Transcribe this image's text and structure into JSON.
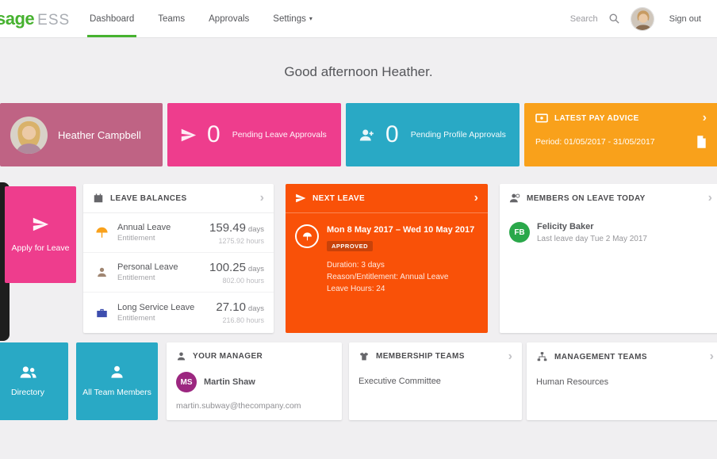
{
  "colors": {
    "sage_green": "#46b22f",
    "pink": "#ee3d8d",
    "mauve": "#bf6384",
    "cyan": "#29a9c5",
    "amber": "#f9a11b",
    "orange": "#f95108",
    "fb_green": "#2aa84a",
    "ms_purple": "#9c2780"
  },
  "icons": {
    "chevron_right": "›",
    "caret_down": "▾"
  },
  "header": {
    "logo_sage": "sage",
    "logo_ess": "ESS",
    "nav": [
      {
        "label": "Dashboard"
      },
      {
        "label": "Teams"
      },
      {
        "label": "Approvals"
      },
      {
        "label": "Settings"
      }
    ],
    "search_label": "Search",
    "sign_out": "Sign out"
  },
  "greeting": "Good afternoon Heather.",
  "profile_card": {
    "name": "Heather Campbell"
  },
  "pending_leave": {
    "count": "0",
    "label": "Pending Leave Approvals"
  },
  "pending_profile": {
    "count": "0",
    "label": "Pending Profile Approvals"
  },
  "pay_advice": {
    "title": "LATEST PAY ADVICE",
    "period": "Period: 01/05/2017 - 31/05/2017"
  },
  "apply_leave": {
    "label": "Apply for Leave"
  },
  "leave_balances": {
    "title": "LEAVE BALANCES",
    "rows": [
      {
        "name": "Annual Leave",
        "sub": "Entitlement",
        "value": "159.49",
        "unit": "days",
        "hours": "1275.92 hours"
      },
      {
        "name": "Personal Leave",
        "sub": "Entitlement",
        "value": "100.25",
        "unit": "days",
        "hours": "802.00 hours"
      },
      {
        "name": "Long Service Leave",
        "sub": "Entitlement",
        "value": "27.10",
        "unit": "days",
        "hours": "216.80 hours"
      }
    ]
  },
  "next_leave": {
    "title": "NEXT LEAVE",
    "date_range": "Mon 8 May 2017 – Wed 10 May 2017",
    "status": "APPROVED",
    "lines": [
      "Duration: 3 days",
      "Reason/Entitlement: Annual Leave",
      "Leave Hours: 24"
    ]
  },
  "members_on_leave": {
    "title": "MEMBERS ON LEAVE TODAY",
    "initials": "FB",
    "name": "Felicity Baker",
    "detail": "Last leave day Tue 2 May 2017"
  },
  "directory": {
    "label": "Directory"
  },
  "all_team_members": {
    "label": "All Team Members"
  },
  "your_manager": {
    "title": "YOUR MANAGER",
    "initials": "MS",
    "name": "Martin Shaw",
    "email": "martin.subway@thecompany.com"
  },
  "membership_teams": {
    "title": "MEMBERSHIP TEAMS",
    "value": "Executive Committee"
  },
  "management_teams": {
    "title": "MANAGEMENT TEAMS",
    "value": "Human Resources"
  }
}
